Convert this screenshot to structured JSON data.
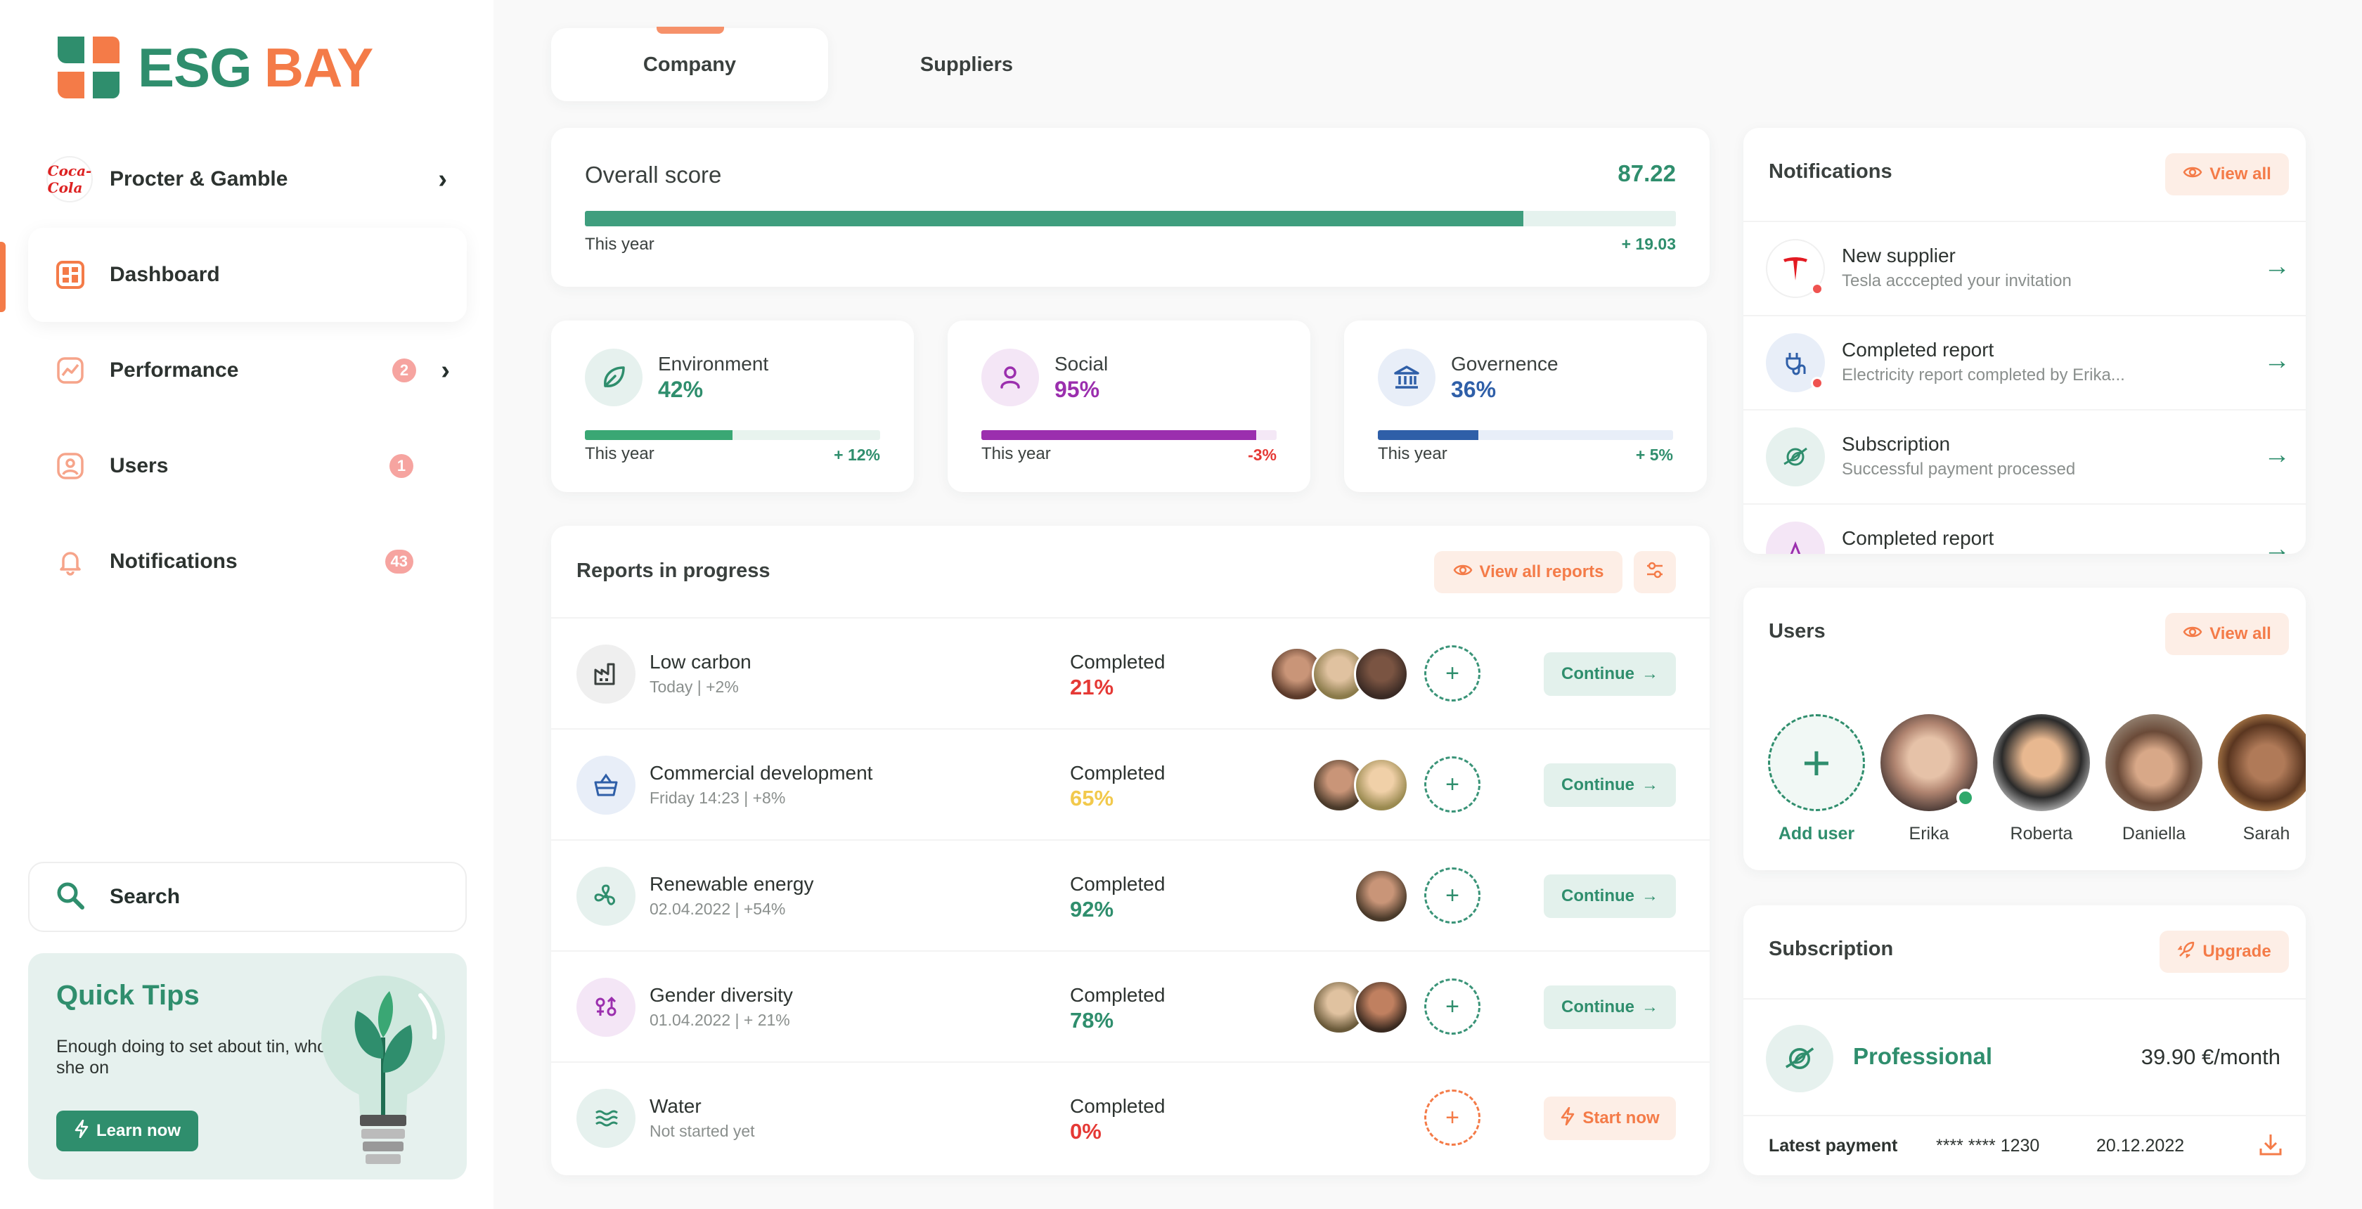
{
  "brand": {
    "part1": "ESG",
    "part2": "BAY"
  },
  "company": {
    "logo_text": "Coca-Cola",
    "name": "Procter & Gamble"
  },
  "nav": [
    {
      "label": "Dashboard",
      "badge": ""
    },
    {
      "label": "Performance",
      "badge": "2"
    },
    {
      "label": "Users",
      "badge": "1"
    },
    {
      "label": "Notifications",
      "badge": "43"
    }
  ],
  "search": {
    "label": "Search"
  },
  "tips": {
    "title": "Quick Tips",
    "text": "Enough doing to set about tin, who she on",
    "button": "Learn now"
  },
  "tabs": [
    "Company",
    "Suppliers"
  ],
  "overall": {
    "title": "Overall score",
    "value": "87.22",
    "period": "This year",
    "delta": "+ 19.03",
    "progress": 0.86
  },
  "pillars": [
    {
      "name": "Environment",
      "percent": "42%",
      "progress": 0.5,
      "period": "This year",
      "delta": "+ 12%",
      "color": "#3aa774",
      "icon": "leaf-icon"
    },
    {
      "name": "Social",
      "percent": "95%",
      "progress": 0.93,
      "period": "This year",
      "delta": "-3%",
      "color": "#9b2fae",
      "icon": "person-icon"
    },
    {
      "name": "Governence",
      "percent": "36%",
      "progress": 0.34,
      "period": "This year",
      "delta": "+ 5%",
      "color": "#2f5fa8",
      "icon": "bank-icon"
    }
  ],
  "reports": {
    "title": "Reports in progress",
    "view_all": "View all reports",
    "completed_label": "Completed",
    "continue_label": "Continue",
    "start_label": "Start now",
    "rows": [
      {
        "name": "Low carbon",
        "sub": "Today | +2%",
        "percent": "21%",
        "color": "#e53935",
        "icon": "factory-icon"
      },
      {
        "name": "Commercial development",
        "sub": "Friday 14:23 | +8%",
        "percent": "65%",
        "color": "#f2c94c",
        "icon": "basket-icon"
      },
      {
        "name": "Renewable energy",
        "sub": "02.04.2022 | +54%",
        "percent": "92%",
        "color": "#2f8e6d",
        "icon": "fan-icon"
      },
      {
        "name": "Gender diversity",
        "sub": "01.04.2022 | + 21%",
        "percent": "78%",
        "color": "#2f8e6d",
        "icon": "gender-icon"
      },
      {
        "name": "Water",
        "sub": "Not started yet",
        "percent": "0%",
        "color": "#e53935",
        "icon": "water-icon"
      }
    ]
  },
  "notifications": {
    "title": "Notifications",
    "view_all": "View all",
    "items": [
      {
        "title": "New supplier",
        "desc": "Tesla acccepted your invitation"
      },
      {
        "title": "Completed report",
        "desc": "Electricity report completed by Erika..."
      },
      {
        "title": "Subscription",
        "desc": "Successful payment processed"
      },
      {
        "title": "Completed report",
        "desc": ""
      }
    ]
  },
  "users": {
    "title": "Users",
    "view_all": "View all",
    "add_label": "Add user",
    "people": [
      "Erika",
      "Roberta",
      "Daniella",
      "Sarah"
    ]
  },
  "subscription": {
    "title": "Subscription",
    "upgrade": "Upgrade",
    "plan": "Professional",
    "price": "39.90 €/month",
    "latest_label": "Latest payment",
    "card": "**** **** 1230",
    "date": "20.12.2022"
  },
  "colors": {
    "accent": "#2f8e6d",
    "orange": "#f47b48"
  }
}
